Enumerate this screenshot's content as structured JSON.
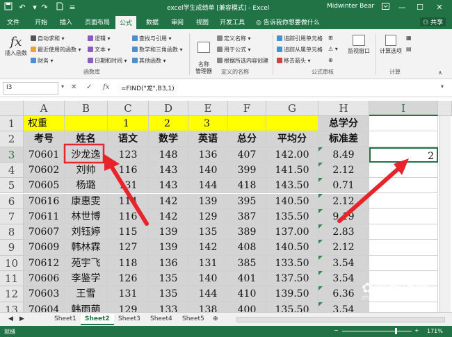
{
  "titlebar": {
    "title": "excel学生成绩单 [兼容模式] - Excel",
    "user": "Midwinter Bear",
    "qat": [
      "save-icon",
      "undo-icon",
      "redo-icon",
      "new-file-icon",
      "customize-icon"
    ]
  },
  "menu": {
    "tabs": [
      "文件",
      "开始",
      "插入",
      "页面布局",
      "公式",
      "数据",
      "审阅",
      "视图",
      "开发工具"
    ],
    "tell_me": "告诉我你想要做什么",
    "share": "共享"
  },
  "ribbon": {
    "insert_function": "插入函数",
    "lib": [
      "自动求和",
      "最近使用的函数",
      "财务",
      "逻辑",
      "文本",
      "日期和时间",
      "查找与引用",
      "数学和三角函数",
      "其他函数"
    ],
    "group_lib": "函数库",
    "name_manager": "名称\n管理器",
    "names": [
      "定义名称",
      "用于公式",
      "根据所选内容创建"
    ],
    "group_names": "定义的名称",
    "audit": [
      "追踪引用单元格",
      "追踪从属单元格",
      "移去箭头"
    ],
    "group_audit": "公式审核",
    "watch": "监视窗口",
    "calc_options": "计算选项",
    "group_calc": "计算"
  },
  "formula_bar": {
    "name_box": "I3",
    "formula": "=FIND(\"龙\",B3,1)"
  },
  "columns": [
    "A",
    "B",
    "C",
    "D",
    "E",
    "F",
    "G",
    "H",
    "I"
  ],
  "rows": [
    "1",
    "2",
    "3",
    "4",
    "5",
    "6",
    "7",
    "8",
    "9",
    "10",
    "11",
    "12",
    "13"
  ],
  "grid": [
    [
      "权重",
      "",
      "1",
      "2",
      "3",
      "",
      "",
      "总学分",
      ""
    ],
    [
      "考号",
      "姓名",
      "语文",
      "数学",
      "英语",
      "总分",
      "平均分",
      "标准差",
      ""
    ],
    [
      "70601",
      "沙龙逸",
      "123",
      "148",
      "136",
      "407",
      "142.00",
      "8.49",
      "2"
    ],
    [
      "70602",
      "刘帅",
      "116",
      "143",
      "140",
      "399",
      "141.50",
      "2.12",
      ""
    ],
    [
      "70605",
      "杨璐",
      "131",
      "143",
      "144",
      "418",
      "143.50",
      "0.71",
      ""
    ],
    [
      "70616",
      "康惠雯",
      "114",
      "142",
      "139",
      "395",
      "140.50",
      "2.12",
      ""
    ],
    [
      "70611",
      "林世博",
      "116",
      "142",
      "129",
      "387",
      "135.50",
      "9.19",
      ""
    ],
    [
      "70607",
      "刘钰婷",
      "115",
      "139",
      "135",
      "389",
      "137.00",
      "2.83",
      ""
    ],
    [
      "70609",
      "韩林霖",
      "127",
      "139",
      "142",
      "408",
      "140.50",
      "2.12",
      ""
    ],
    [
      "70612",
      "苑宇飞",
      "118",
      "136",
      "131",
      "385",
      "133.50",
      "3.54",
      ""
    ],
    [
      "70606",
      "李鉴学",
      "126",
      "135",
      "140",
      "401",
      "137.50",
      "3.54",
      ""
    ],
    [
      "70603",
      "王雪",
      "131",
      "135",
      "144",
      "410",
      "139.50",
      "6.36",
      ""
    ],
    [
      "70604",
      "韩雨萌",
      "129",
      "133",
      "138",
      "400",
      "135.50",
      "3.54",
      ""
    ]
  ],
  "sheets": [
    "Sheet1",
    "Sheet2",
    "Sheet3",
    "Sheet4",
    "Sheet5"
  ],
  "status": {
    "ready": "就绪",
    "zoom": "171%"
  },
  "watermark": "搜狗指南",
  "watermark_url": "zhinan.sogou.com"
}
